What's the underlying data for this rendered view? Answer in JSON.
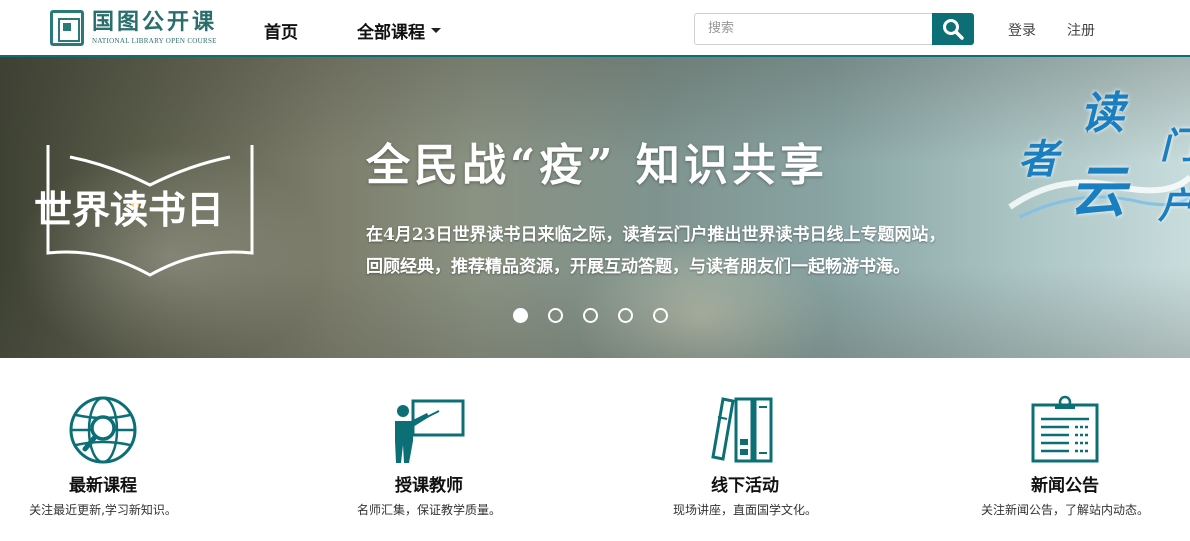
{
  "header": {
    "logo_cn": "国图公开课",
    "logo_en": "NATIONAL LIBRARY OPEN COURSE",
    "nav_home": "首页",
    "nav_courses": "全部课程",
    "search_placeholder": "搜索",
    "login": "登录",
    "register": "注册"
  },
  "banner": {
    "book_logo_text": "世界读书日",
    "headline": "全民战“疫” 知识共享",
    "desc_line1": "在4月23日世界读书日来临之际，读者云门户推出世界读书日线上专题网站，",
    "desc_line2": "回顾经典，推荐精品资源，开展互动答题，与读者朋友们一起畅游书海。",
    "cloud_chars": [
      "读",
      "者",
      "云",
      "门",
      "户"
    ],
    "slides": [
      {
        "active": true
      },
      {
        "active": false
      },
      {
        "active": false
      },
      {
        "active": false
      },
      {
        "active": false
      }
    ]
  },
  "features": [
    {
      "icon": "globe-search-icon",
      "title": "最新课程",
      "desc": "关注最近更新,学习新知识。"
    },
    {
      "icon": "teacher-icon",
      "title": "授课教师",
      "desc": "名师汇集，保证教学质量。"
    },
    {
      "icon": "books-icon",
      "title": "线下活动",
      "desc": "现场讲座，直面国学文化。"
    },
    {
      "icon": "clipboard-icon",
      "title": "新闻公告",
      "desc": "关注新闻公告，了解站内动态。"
    }
  ],
  "colors": {
    "brand": "#0d6f76",
    "logo": "#2a6d6d",
    "cloud": "#1a7fc0"
  }
}
